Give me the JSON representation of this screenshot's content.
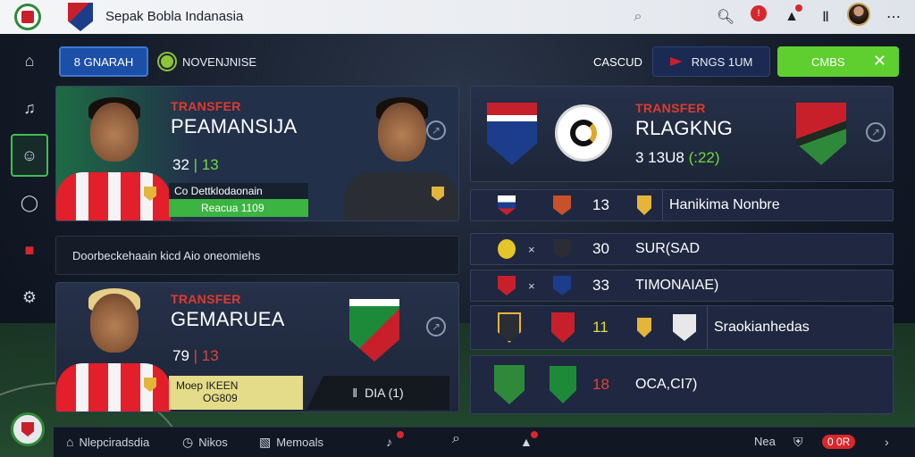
{
  "app": {
    "title": "Sepak Bobla Indanasia"
  },
  "topbar": {
    "notification_count": "!",
    "alert_count": "!"
  },
  "sidebar": {
    "items": [
      {
        "icon": "home-icon"
      },
      {
        "icon": "music-note-icon"
      },
      {
        "icon": "players-icon"
      },
      {
        "icon": "chat-icon"
      },
      {
        "icon": "flag-icon"
      },
      {
        "icon": "settings-icon"
      }
    ]
  },
  "actions": {
    "primary_label": "8 GNARAH",
    "nov_label": "NOVENJNISE",
    "cascud_label": "CASCUD",
    "navy_label": "RNGS 1UM",
    "green_label": "CMBS"
  },
  "card_transfer_1": {
    "tag": "TRANSFER",
    "name": "PEAMANSIJA",
    "stat": "32",
    "stat_green": "13",
    "box_top": "Co Dettklodaonain",
    "box_bottom": "Reacua 1109"
  },
  "search": {
    "text": "Doorbeckehaain kicd Aio oneomiehs"
  },
  "card_transfer_2": {
    "tag": "TRANSFER",
    "name": "GEMARUEA",
    "stat": "79",
    "stat_red": "13",
    "yellow_line1": "Moep IKEEN",
    "yellow_line2": "OG809",
    "pill_text": "DIA (1)"
  },
  "card_ranking": {
    "tag": "TRANSFER",
    "name": "RLAGKNG",
    "stat": "3 13U8",
    "stat_green": "(:22)"
  },
  "ranking_rows": [
    {
      "num": "13",
      "name": "Hanikima Nonbre",
      "num_style": "white"
    },
    {
      "num": "30",
      "name": "SUR(SAD",
      "num_style": "white"
    },
    {
      "num": "33",
      "name": "TIMONAIAE)",
      "num_style": "white"
    },
    {
      "num": "11",
      "name": "Sraokianhedas",
      "num_style": "yellow"
    },
    {
      "num": "18",
      "name": "OCA,CI7)",
      "num_style": "red"
    }
  ],
  "bottomnav": {
    "item1": "Nlepciradsdia",
    "item2": "Nikos",
    "item3": "Memoals",
    "right_label": "Nea",
    "right_pill": "0 0R"
  },
  "colors": {
    "accent_green": "#5fcf2f",
    "accent_blue": "#1c4fa8",
    "transfer_red": "#e03a2e",
    "alert_red": "#d7272d"
  }
}
